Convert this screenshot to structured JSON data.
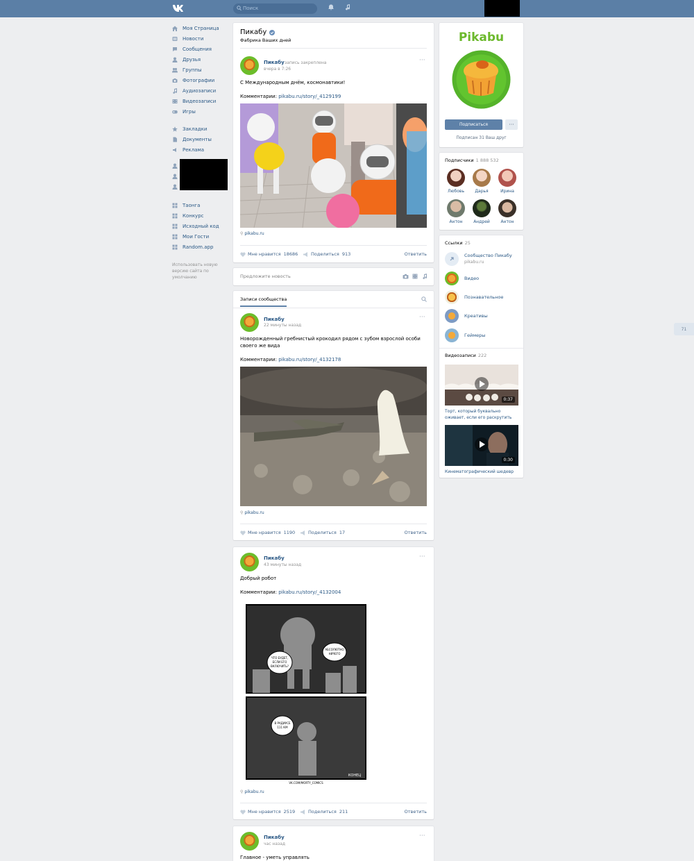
{
  "header": {
    "search_placeholder": "Поиск",
    "counter": "71"
  },
  "nav": {
    "items": [
      {
        "label": "Моя Страница",
        "icon": "home-icon"
      },
      {
        "label": "Новости",
        "icon": "news-icon"
      },
      {
        "label": "Сообщения",
        "icon": "messages-icon"
      },
      {
        "label": "Друзья",
        "icon": "friends-icon"
      },
      {
        "label": "Группы",
        "icon": "groups-icon"
      },
      {
        "label": "Фотографии",
        "icon": "photo-icon"
      },
      {
        "label": "Аудиозаписи",
        "icon": "music-icon"
      },
      {
        "label": "Видеозаписи",
        "icon": "video-icon"
      },
      {
        "label": "Игры",
        "icon": "games-icon"
      }
    ],
    "items2": [
      {
        "label": "Закладки",
        "icon": "star-icon"
      },
      {
        "label": "Документы",
        "icon": "document-icon"
      },
      {
        "label": "Реклама",
        "icon": "ads-icon"
      }
    ],
    "apps": [
      {
        "label": "Таонга"
      },
      {
        "label": "Конкурс"
      },
      {
        "label": "Исходный код"
      },
      {
        "label": "Мои Гости"
      },
      {
        "label": "Random.app"
      }
    ],
    "note": "Использовать новую версию сайта по умолчанию"
  },
  "group": {
    "name": "Пикабу",
    "status": "Фабрика Ваших дней",
    "brand": "Pikabu",
    "subscribe": "Подписаться",
    "friend_sub": "Подписан 31 Ваш друг",
    "subscribers_title": "Подписчики",
    "subscribers_count": "1 888 532",
    "subscribers": [
      "Любовь",
      "Дарья",
      "Ирина",
      "Антон",
      "Андрей",
      "Антон"
    ],
    "links_title": "Ссылки",
    "links_count": "25",
    "links": [
      {
        "title": "Сообщество Пикабу",
        "sub": "pikabu.ru"
      },
      {
        "title": "Видео",
        "sub": ""
      },
      {
        "title": "Познавательное",
        "sub": ""
      },
      {
        "title": "Креативы",
        "sub": ""
      },
      {
        "title": "Геймеры",
        "sub": ""
      }
    ],
    "videos_title": "Видеозаписи",
    "videos_count": "222",
    "videos": [
      {
        "title": "Торт, который буквально оживает, если его раскрутить",
        "duration": "0:37"
      },
      {
        "title": "Кинематографический шедевр",
        "duration": "0:30"
      }
    ]
  },
  "pinned": {
    "author": "Пикабу",
    "pinned_label": "запись закреплена",
    "time": "вчера в 7:26",
    "text": "С Международным днём, космонавтики!",
    "comments_label": "Комментарии:",
    "link": "pikabu.ru/story/_4129199",
    "source": "pikabu.ru",
    "likes_label": "Мне нравится",
    "likes": "18686",
    "share_label": "Поделиться",
    "shares": "913",
    "reply": "Ответить"
  },
  "suggest": {
    "placeholder": "Предложите новость"
  },
  "wall_tab": "Записи сообщества",
  "posts": [
    {
      "author": "Пикабу",
      "time": "22 минуты назад",
      "text": "Новорожденный гребнистый крокодил рядом с зубом взрослой особи своего же вида",
      "comments_label": "Комментарии:",
      "link": "pikabu.ru/story/_4132178",
      "source": "pikabu.ru",
      "likes_label": "Мне нравится",
      "likes": "1190",
      "share_label": "Поделиться",
      "shares": "17",
      "reply": "Ответить"
    },
    {
      "author": "Пикабу",
      "time": "43 минуты назад",
      "text": "Добрый робот",
      "comments_label": "Комментарии:",
      "link": "pikabu.ru/story/_4132004",
      "source": "pikabu.ru",
      "likes_label": "Мне нравится",
      "likes": "2519",
      "share_label": "Поделиться",
      "shares": "211",
      "reply": "Ответить",
      "comic_texts": [
        "ЧТО БУДЕТ, ЕСЛИ ЕГО ВКЛЮЧИТЬ?",
        "АБСОЛЮТНО НИЧЕГО",
        "В РАДИУСЕ 111 КМ",
        "КОНЕЦ",
        "VK.COM/MORTY_COMICS"
      ]
    },
    {
      "author": "Пикабу",
      "time": "час назад",
      "text": "Главное - уметь управлять"
    }
  ]
}
